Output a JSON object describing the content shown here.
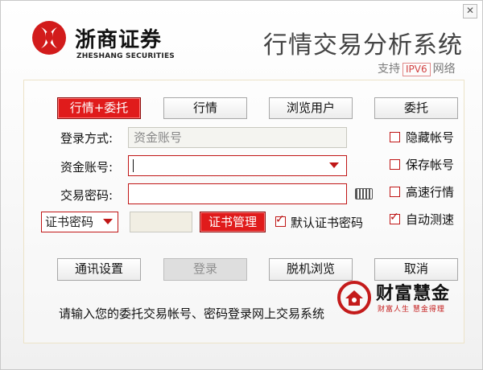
{
  "window": {
    "close_symbol": "✕"
  },
  "header": {
    "brand_cn": "浙商证券",
    "brand_en": "ZHESHANG SECURITIES",
    "app_title": "行情交易分析系统",
    "ipv6_prefix": "支持",
    "ipv6_badge": "IPV6",
    "ipv6_suffix": "网络",
    "brand_color": "#d21b1b"
  },
  "mode_tabs": [
    {
      "label": "行情+委托",
      "active": true
    },
    {
      "label": "行情",
      "active": false
    },
    {
      "label": "浏览用户",
      "active": false
    },
    {
      "label": "委托",
      "active": false
    }
  ],
  "form": {
    "login_method_label": "登录方式:",
    "login_method_value": "资金账号",
    "account_label": "资金账号:",
    "account_value": "",
    "password_label": "交易密码:",
    "password_value": "",
    "cert_select_value": "证书密码",
    "cert_password_value": "",
    "cert_manage_label": "证书管理",
    "default_cert_label": "默认证书密码",
    "default_cert_checked": true
  },
  "options": [
    {
      "label": "隐藏帐号",
      "checked": false
    },
    {
      "label": "保存帐号",
      "checked": false
    },
    {
      "label": "高速行情",
      "checked": false
    },
    {
      "label": "自动测速",
      "checked": true
    }
  ],
  "actions": {
    "comm_settings": "通讯设置",
    "login": "登录",
    "offline_browse": "脱机浏览",
    "cancel": "取消"
  },
  "status_message": "请输入您的委托交易帐号、密码登录网上交易系统",
  "watermark": {
    "title": "财富慧金",
    "subtitle": "财富人生  慧金得理"
  },
  "icons": {
    "keyboard": "keyboard-icon",
    "dropdown": "chevron-down-icon",
    "check": "check-icon",
    "logo": "zheshang-logo-icon"
  }
}
